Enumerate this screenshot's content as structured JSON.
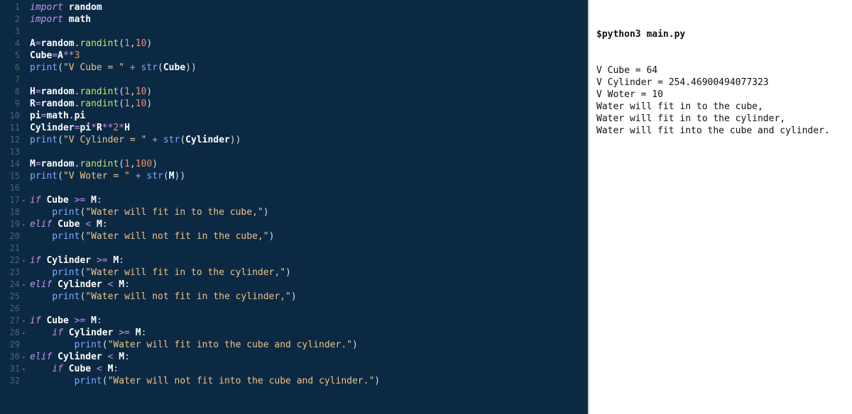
{
  "editor": {
    "lines": [
      {
        "n": 1,
        "fold": "",
        "tokens": [
          [
            "kw",
            "import"
          ],
          [
            "",
            ", "
          ],
          [
            "mod",
            "random"
          ]
        ]
      },
      {
        "n": 2,
        "fold": "",
        "tokens": [
          [
            "kw",
            "import"
          ],
          [
            "",
            ", "
          ],
          [
            "mod",
            "math"
          ]
        ]
      },
      {
        "n": 3,
        "fold": "",
        "tokens": []
      },
      {
        "n": 4,
        "fold": "",
        "tokens": [
          [
            "id",
            "A"
          ],
          [
            "op",
            "="
          ],
          [
            "id",
            "random"
          ],
          [
            "pun",
            "."
          ],
          [
            "call",
            "randint"
          ],
          [
            "pun",
            "("
          ],
          [
            "num",
            "1"
          ],
          [
            "pun",
            ","
          ],
          [
            "num",
            "10"
          ],
          [
            "pun",
            ")"
          ]
        ]
      },
      {
        "n": 5,
        "fold": "",
        "tokens": [
          [
            "id",
            "Cube"
          ],
          [
            "op",
            "="
          ],
          [
            "id",
            "A"
          ],
          [
            "op",
            "**"
          ],
          [
            "num",
            "3"
          ]
        ]
      },
      {
        "n": 6,
        "fold": "",
        "tokens": [
          [
            "fn",
            "print"
          ],
          [
            "pun",
            "("
          ],
          [
            "str",
            "\"V Cube = \""
          ],
          [
            "",
            ", "
          ],
          [
            "op",
            "+"
          ],
          [
            "",
            ", "
          ],
          [
            "fn",
            "str"
          ],
          [
            "pun",
            "("
          ],
          [
            "id",
            "Cube"
          ],
          [
            "pun",
            "))"
          ]
        ]
      },
      {
        "n": 7,
        "fold": "",
        "tokens": []
      },
      {
        "n": 8,
        "fold": "",
        "tokens": [
          [
            "id",
            "H"
          ],
          [
            "op",
            "="
          ],
          [
            "id",
            "random"
          ],
          [
            "pun",
            "."
          ],
          [
            "call",
            "randint"
          ],
          [
            "pun",
            "("
          ],
          [
            "num",
            "1"
          ],
          [
            "pun",
            ","
          ],
          [
            "num",
            "10"
          ],
          [
            "pun",
            ")"
          ]
        ]
      },
      {
        "n": 9,
        "fold": "",
        "tokens": [
          [
            "id",
            "R"
          ],
          [
            "op",
            "="
          ],
          [
            "id",
            "random"
          ],
          [
            "pun",
            "."
          ],
          [
            "call",
            "randint"
          ],
          [
            "pun",
            "("
          ],
          [
            "num",
            "1"
          ],
          [
            "pun",
            ","
          ],
          [
            "num",
            "10"
          ],
          [
            "pun",
            ")"
          ]
        ]
      },
      {
        "n": 10,
        "fold": "",
        "tokens": [
          [
            "id",
            "pi"
          ],
          [
            "op",
            "="
          ],
          [
            "id",
            "math"
          ],
          [
            "pun",
            "."
          ],
          [
            "id",
            "pi"
          ]
        ]
      },
      {
        "n": 11,
        "fold": "",
        "tokens": [
          [
            "id",
            "Cylinder"
          ],
          [
            "op",
            "="
          ],
          [
            "id",
            "pi"
          ],
          [
            "op",
            "*"
          ],
          [
            "id",
            "R"
          ],
          [
            "op",
            "**"
          ],
          [
            "num",
            "2"
          ],
          [
            "op",
            "*"
          ],
          [
            "id",
            "H"
          ]
        ]
      },
      {
        "n": 12,
        "fold": "",
        "tokens": [
          [
            "fn",
            "print"
          ],
          [
            "pun",
            "("
          ],
          [
            "str",
            "\"V Cylinder = \""
          ],
          [
            "",
            ", "
          ],
          [
            "op",
            "+"
          ],
          [
            "",
            ", "
          ],
          [
            "fn",
            "str"
          ],
          [
            "pun",
            "("
          ],
          [
            "id",
            "Cylinder"
          ],
          [
            "pun",
            "))"
          ]
        ]
      },
      {
        "n": 13,
        "fold": "",
        "tokens": []
      },
      {
        "n": 14,
        "fold": "",
        "tokens": [
          [
            "id",
            "M"
          ],
          [
            "op",
            "="
          ],
          [
            "id",
            "random"
          ],
          [
            "pun",
            "."
          ],
          [
            "call",
            "randint"
          ],
          [
            "pun",
            "("
          ],
          [
            "num",
            "1"
          ],
          [
            "pun",
            ","
          ],
          [
            "num",
            "100"
          ],
          [
            "pun",
            ")"
          ]
        ]
      },
      {
        "n": 15,
        "fold": "",
        "tokens": [
          [
            "fn",
            "print"
          ],
          [
            "pun",
            "("
          ],
          [
            "str",
            "\"V Woter = \""
          ],
          [
            "",
            ", "
          ],
          [
            "op",
            "+"
          ],
          [
            "",
            ", "
          ],
          [
            "fn",
            "str"
          ],
          [
            "pun",
            "("
          ],
          [
            "id",
            "M"
          ],
          [
            "pun",
            "))"
          ]
        ]
      },
      {
        "n": 16,
        "fold": "",
        "tokens": []
      },
      {
        "n": 17,
        "fold": "▾",
        "tokens": [
          [
            "kw",
            "if"
          ],
          [
            "",
            ", "
          ],
          [
            "id",
            "Cube"
          ],
          [
            "",
            ", "
          ],
          [
            "op",
            ">="
          ],
          [
            "",
            ", "
          ],
          [
            "id",
            "M"
          ],
          [
            "pun",
            ":"
          ]
        ]
      },
      {
        "n": 18,
        "fold": "",
        "tokens": [
          [
            "",
            "    "
          ],
          [
            "fn",
            "print"
          ],
          [
            "pun",
            "("
          ],
          [
            "str",
            "\"Water will fit in to the cube,\""
          ],
          [
            "pun",
            ")"
          ]
        ]
      },
      {
        "n": 19,
        "fold": "▾",
        "tokens": [
          [
            "kw",
            "elif"
          ],
          [
            "",
            ", "
          ],
          [
            "id",
            "Cube"
          ],
          [
            "",
            ", "
          ],
          [
            "op",
            "<"
          ],
          [
            "",
            ", "
          ],
          [
            "id",
            "M"
          ],
          [
            "pun",
            ":"
          ]
        ]
      },
      {
        "n": 20,
        "fold": "",
        "tokens": [
          [
            "",
            "    "
          ],
          [
            "fn",
            "print"
          ],
          [
            "pun",
            "("
          ],
          [
            "str",
            "\"Water will not fit in the cube,\""
          ],
          [
            "pun",
            ")"
          ]
        ]
      },
      {
        "n": 21,
        "fold": "",
        "tokens": []
      },
      {
        "n": 22,
        "fold": "▾",
        "tokens": [
          [
            "kw",
            "if"
          ],
          [
            "",
            ", "
          ],
          [
            "id",
            "Cylinder"
          ],
          [
            "",
            ", "
          ],
          [
            "op",
            ">="
          ],
          [
            "",
            ", "
          ],
          [
            "id",
            "M"
          ],
          [
            "pun",
            ":"
          ]
        ]
      },
      {
        "n": 23,
        "fold": "",
        "tokens": [
          [
            "",
            "    "
          ],
          [
            "fn",
            "print"
          ],
          [
            "pun",
            "("
          ],
          [
            "str",
            "\"Water will fit in to the cylinder,\""
          ],
          [
            "pun",
            ")"
          ]
        ]
      },
      {
        "n": 24,
        "fold": "▾",
        "tokens": [
          [
            "kw",
            "elif"
          ],
          [
            "",
            ", "
          ],
          [
            "id",
            "Cylinder"
          ],
          [
            "",
            ", "
          ],
          [
            "op",
            "<"
          ],
          [
            "",
            ", "
          ],
          [
            "id",
            "M"
          ],
          [
            "pun",
            ":"
          ]
        ]
      },
      {
        "n": 25,
        "fold": "",
        "tokens": [
          [
            "",
            "    "
          ],
          [
            "fn",
            "print"
          ],
          [
            "pun",
            "("
          ],
          [
            "str",
            "\"Water will not fit in the cylinder,\""
          ],
          [
            "pun",
            ")"
          ]
        ]
      },
      {
        "n": 26,
        "fold": "",
        "tokens": []
      },
      {
        "n": 27,
        "fold": "▾",
        "tokens": [
          [
            "kw",
            "if"
          ],
          [
            "",
            ", "
          ],
          [
            "id",
            "Cube"
          ],
          [
            "",
            ", "
          ],
          [
            "op",
            ">="
          ],
          [
            "",
            ", "
          ],
          [
            "id",
            "M"
          ],
          [
            "pun",
            ":"
          ]
        ]
      },
      {
        "n": 28,
        "fold": "▾",
        "tokens": [
          [
            "",
            "    "
          ],
          [
            "kw",
            "if"
          ],
          [
            "",
            ", "
          ],
          [
            "id",
            "Cylinder"
          ],
          [
            "",
            ", "
          ],
          [
            "op",
            ">="
          ],
          [
            "",
            ", "
          ],
          [
            "id",
            "M"
          ],
          [
            "pun",
            ":"
          ]
        ]
      },
      {
        "n": 29,
        "fold": "",
        "tokens": [
          [
            "",
            "        "
          ],
          [
            "fn",
            "print"
          ],
          [
            "pun",
            "("
          ],
          [
            "str",
            "\"Water will fit into the cube and cylinder.\""
          ],
          [
            "pun",
            ")"
          ]
        ]
      },
      {
        "n": 30,
        "fold": "▾",
        "tokens": [
          [
            "kw",
            "elif"
          ],
          [
            "",
            ", "
          ],
          [
            "id",
            "Cylinder"
          ],
          [
            "",
            ", "
          ],
          [
            "op",
            "<"
          ],
          [
            "",
            ", "
          ],
          [
            "id",
            "M"
          ],
          [
            "pun",
            ":"
          ]
        ]
      },
      {
        "n": 31,
        "fold": "▾",
        "tokens": [
          [
            "",
            "    "
          ],
          [
            "kw",
            "if"
          ],
          [
            "",
            ", "
          ],
          [
            "id",
            "Cube"
          ],
          [
            "",
            ", "
          ],
          [
            "op",
            "<"
          ],
          [
            "",
            ", "
          ],
          [
            "id",
            "M"
          ],
          [
            "pun",
            ":"
          ]
        ]
      },
      {
        "n": 32,
        "fold": "",
        "tokens": [
          [
            "",
            "        "
          ],
          [
            "fn",
            "print"
          ],
          [
            "pun",
            "("
          ],
          [
            "str",
            "\"Water will not fit into the cube and cylinder.\""
          ],
          [
            "pun",
            ")"
          ]
        ]
      }
    ]
  },
  "terminal": {
    "command": "$python3 main.py",
    "output": [
      "V Cube = 64",
      "V Cylinder = 254.46900494077323",
      "V Woter = 10",
      "Water will fit in to the cube,",
      "Water will fit in to the cylinder,",
      "Water will fit into the cube and cylinder."
    ]
  }
}
